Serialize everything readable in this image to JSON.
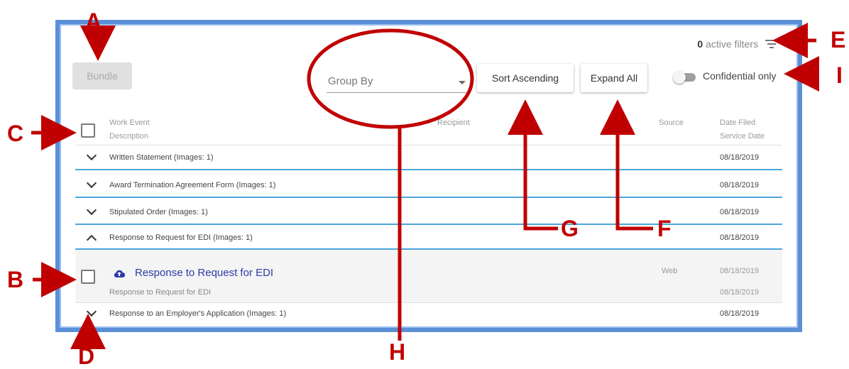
{
  "toolbar": {
    "bundle_label": "Bundle",
    "filters_count": "0",
    "filters_text": " active filters",
    "group_by_placeholder": "Group By",
    "sort_label": "Sort Ascending",
    "expand_label": "Expand All",
    "confidential_label": "Confidential only"
  },
  "table": {
    "headers": {
      "work_event": "Work Event",
      "description": "Description",
      "recipient": "Recipient",
      "source": "Source",
      "date_filed": "Date Filed",
      "service_date": "Service Date"
    },
    "rows": [
      {
        "label": "Written Statement (Images: 1)",
        "date": "08/18/2019"
      },
      {
        "label": "Award Termination Agreement Form (Images: 1)",
        "date": "08/18/2019"
      },
      {
        "label": "Stipulated Order (Images: 1)",
        "date": "08/18/2019"
      },
      {
        "label": "Response to Request for EDI (Images: 1)",
        "date": "08/18/2019"
      },
      {
        "label": "Response to an Employer's Application (Images: 1)",
        "date": "08/18/2019"
      }
    ],
    "detail": {
      "title": "Response to Request for EDI",
      "description": "Response to Request for EDI",
      "source": "Web",
      "date_filed": "08/18/2019",
      "service_date": "08/18/2019"
    }
  },
  "annotations": {
    "A": "A",
    "B": "B",
    "C": "C",
    "D": "D",
    "E": "E",
    "F": "F",
    "G": "G",
    "H": "H",
    "I": "I"
  },
  "colors": {
    "annotation": "#c00000",
    "frame": "#5b8fd8",
    "row_divider": "#4aa6dd",
    "link": "#2b3aa8"
  }
}
